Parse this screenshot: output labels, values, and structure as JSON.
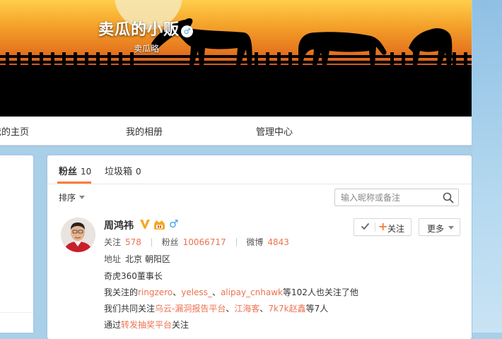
{
  "cover": {
    "title": "卖瓜的小贩",
    "gender_badge": "♂",
    "subtitle": "卖瓜略"
  },
  "nav": {
    "items": [
      "我的主页",
      "我的相册",
      "管理中心"
    ]
  },
  "tabs": [
    {
      "label": "粉丝",
      "count": "10",
      "active": true
    },
    {
      "label": "垃圾箱",
      "count": "0",
      "active": false
    }
  ],
  "sort": {
    "label": "排序"
  },
  "search": {
    "placeholder": "输入昵称或备注"
  },
  "fan": {
    "name": "周鸿祎",
    "gender": "♂",
    "stats": [
      {
        "label": "关注",
        "value": "578"
      },
      {
        "label": "粉丝",
        "value": "10066717"
      },
      {
        "label": "微博",
        "value": "4843"
      }
    ],
    "address_label": "地址",
    "address": "北京 朝阳区",
    "bio": "奇虎360董事长",
    "follow_prefix": "我关注的",
    "follow_users": [
      "ringzero",
      "yeless_",
      "alipay_cnhawk"
    ],
    "follow_sep": "、",
    "follow_suffix": "等102人也关注了他",
    "common_prefix": "我们共同关注",
    "common_users": [
      "乌云-漏洞报告平台",
      "江海客",
      "7k7k赵鑫"
    ],
    "common_suffix": "等7人",
    "via_prefix": "通过",
    "via_link": "转发抽奖平台",
    "via_suffix": "关注",
    "follow_button": "关注",
    "more_button": "更多"
  },
  "colors": {
    "accent": "#eb7350",
    "tab_underline": "#fa7d3c",
    "male_blue": "#3fa0e6",
    "vip_gold": "#f6a823",
    "page_bg": "#a9cfe9"
  }
}
